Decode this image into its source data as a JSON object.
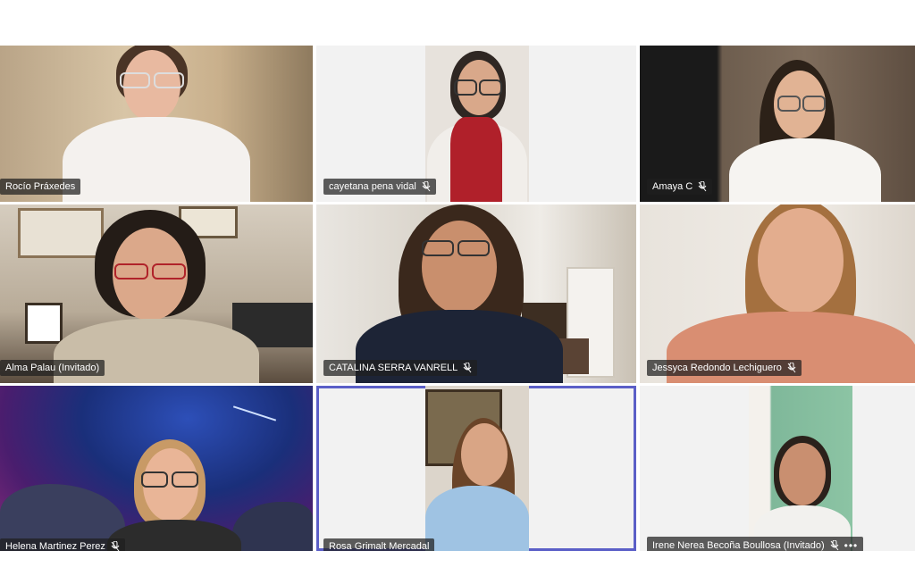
{
  "participants": [
    {
      "name": "Rocío Práxedes",
      "muted": false
    },
    {
      "name": "cayetana pena vidal",
      "muted": true
    },
    {
      "name": "Amaya C",
      "muted": true
    },
    {
      "name": "Alma Palau (Invitado)",
      "muted": false
    },
    {
      "name": "CATALINA SERRA VANRELL",
      "muted": true
    },
    {
      "name": "Jessyca Redondo Lechiguero",
      "muted": true
    },
    {
      "name": "Helena Martinez Perez",
      "muted": true
    },
    {
      "name": "Rosa Grimalt Mercadal",
      "muted": false
    },
    {
      "name": "Irene Nerea Becoña Boullosa (Invitado)",
      "muted": true
    }
  ],
  "colors": {
    "active_speaker_border": "#5b5fc7",
    "name_tag_bg": "#1e1e1e",
    "tile_bg": "#f2f2f2"
  },
  "icons": {
    "muted": "mic-off-icon",
    "more": "more-options-icon"
  },
  "more_label": "•••"
}
